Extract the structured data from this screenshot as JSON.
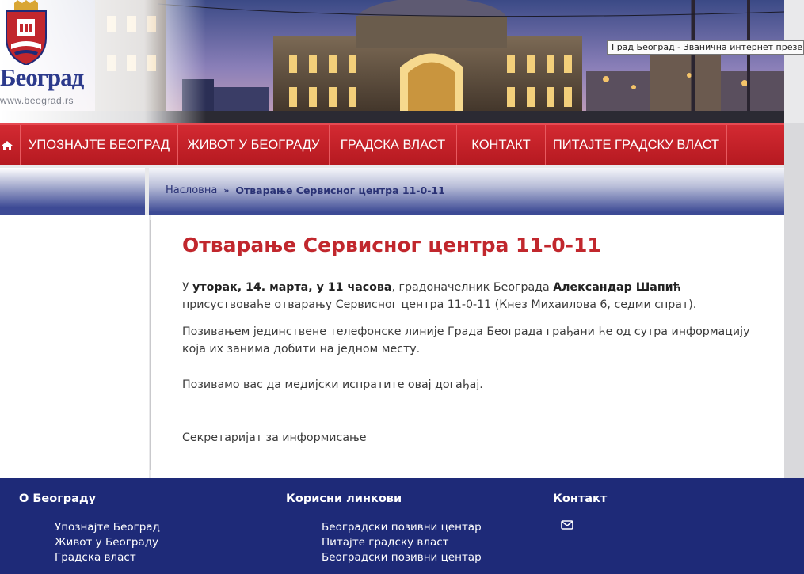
{
  "header": {
    "logo_text": "Београд",
    "logo_url": "www.beograd.rs",
    "tooltip": "Град Београд - Званична интернет презентација"
  },
  "nav": {
    "home_icon": "home-icon",
    "items": [
      {
        "label": "Упознајте Београд"
      },
      {
        "label": "Живот у Београду"
      },
      {
        "label": "Градска власт"
      },
      {
        "label": "Контакт"
      },
      {
        "label": "Питајте градску власт"
      }
    ]
  },
  "breadcrumb": {
    "home": "Насловна",
    "separator": "»",
    "current": "Отварање Сервисног центра 11-0-11"
  },
  "article": {
    "title": "Отварање Сервисног центра 11-0-11",
    "p1": {
      "t1": "У ",
      "b1": "уторак, 14. марта, у 11 часова",
      "t2": ", градоначелник Београда ",
      "b2": "Александар Шапић",
      "t3": " присуствоваће отварању Сервисног центра 11-0-11 (Кнез Михаилова 6, седми спрат)."
    },
    "p2": "Позивањем јединствене телефонске линије Града Београда грађани ће од сутра информацију која их занима добити на једном месту.",
    "p3": "Позивамо вас да медијски испратите овај догађај.",
    "p4": "Секретаријат за информисање"
  },
  "footer": {
    "col1": {
      "heading": "О Београду",
      "links": [
        "Упознајте Београд",
        "Живот у Београду",
        "Градска власт"
      ]
    },
    "col2": {
      "heading": "Корисни линкови",
      "links": [
        "Београдски позивни центар",
        "Питајте градску власт",
        "Београдски позивни центар"
      ]
    },
    "col3": {
      "heading": "Контакт",
      "icon": "envelope-icon"
    }
  },
  "colors": {
    "nav_red": "#c1222a",
    "title_red": "#c1272d",
    "footer_blue": "#1e2a78",
    "crumb_blue": "#3d4a95"
  }
}
